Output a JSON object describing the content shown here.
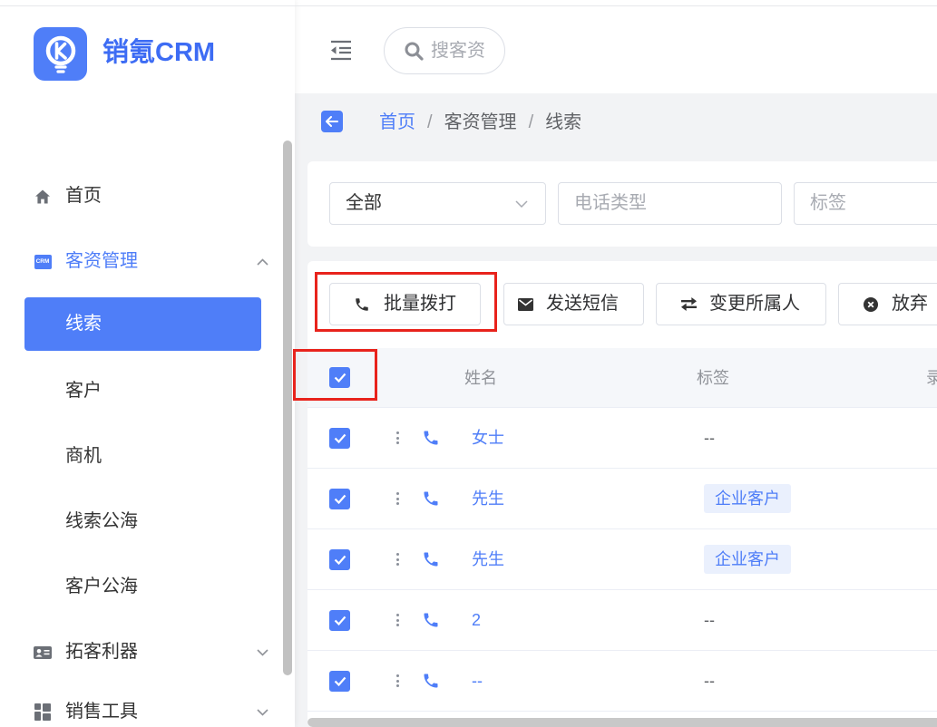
{
  "theme": {
    "primary": "#4f7ef8",
    "highlight_box": "#e8231c",
    "content_bg": "#f2f3f5"
  },
  "brand": {
    "name": "销氪CRM",
    "logo_icon": "brand-logo-icon"
  },
  "header": {
    "collapse_icon": "menu-fold-icon",
    "search": {
      "icon": "search-icon",
      "placeholder": "搜客资"
    }
  },
  "sidebar": {
    "items": [
      {
        "label": "首页",
        "icon": "home-icon",
        "active": false
      },
      {
        "label": "客资管理",
        "icon": "crm-icon",
        "icon_text": "CRM",
        "active": true,
        "expanded": true,
        "children": [
          {
            "label": "线索",
            "active": true
          },
          {
            "label": "客户",
            "active": false
          },
          {
            "label": "商机",
            "active": false
          },
          {
            "label": "线索公海",
            "active": false
          },
          {
            "label": "客户公海",
            "active": false
          }
        ]
      },
      {
        "label": "拓客利器",
        "icon": "id-card-icon",
        "expanded": false
      },
      {
        "label": "销售工具",
        "icon": "grid-icon",
        "expanded": false
      }
    ]
  },
  "breadcrumb": {
    "back_icon": "back-arrow-icon",
    "separator": "/",
    "items": [
      "首页",
      "客资管理",
      "线索"
    ]
  },
  "filters": {
    "scope_select": {
      "value": "全部",
      "icon": "chevron-down-icon"
    },
    "phone_type": {
      "placeholder": "电话类型"
    },
    "tag": {
      "placeholder": "标签"
    }
  },
  "toolbar": {
    "buttons": [
      {
        "label": "批量拨打",
        "icon": "phone-icon",
        "highlighted": true
      },
      {
        "label": "发送短信",
        "icon": "mail-icon",
        "highlighted": false
      },
      {
        "label": "变更所属人",
        "icon": "swap-icon",
        "highlighted": false
      },
      {
        "label": "放弃",
        "icon": "close-circle-icon",
        "highlighted": false
      }
    ]
  },
  "table": {
    "select_all": {
      "checked": true,
      "highlighted": true
    },
    "columns": [
      "姓名",
      "标签",
      "录"
    ],
    "row_icons": {
      "menu": "more-vertical-icon",
      "call": "phone-icon"
    },
    "rows": [
      {
        "checked": true,
        "name": "女士",
        "tag": "--",
        "tag_is_badge": false
      },
      {
        "checked": true,
        "name": "先生",
        "tag": "企业客户",
        "tag_is_badge": true
      },
      {
        "checked": true,
        "name": "先生",
        "tag": "企业客户",
        "tag_is_badge": true
      },
      {
        "checked": true,
        "name": "2",
        "tag": "--",
        "tag_is_badge": false
      },
      {
        "checked": true,
        "name": "--",
        "tag": "--",
        "tag_is_badge": false
      }
    ]
  }
}
